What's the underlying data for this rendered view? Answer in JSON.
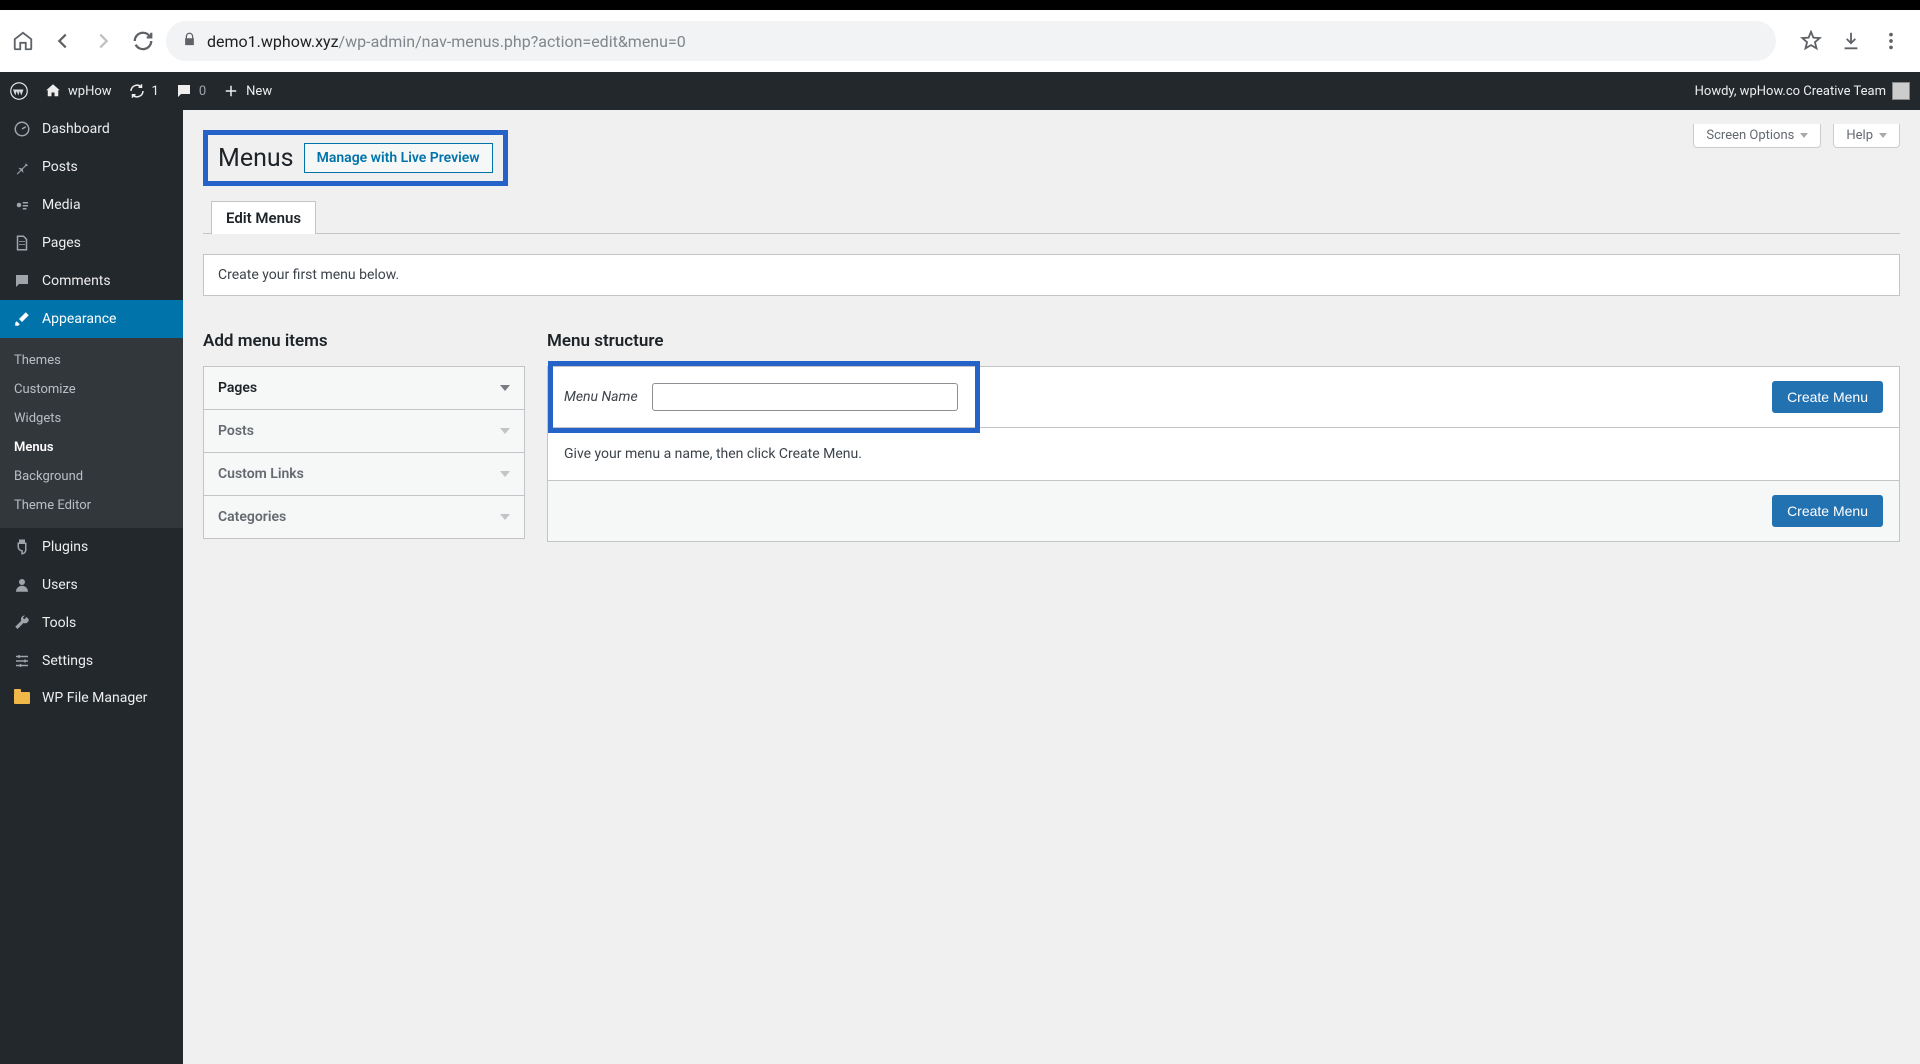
{
  "browser": {
    "url_domain": "demo1.wphow.xyz",
    "url_path": "/wp-admin/nav-menus.php?action=edit&menu=0"
  },
  "adminbar": {
    "site_name": "wpHow",
    "updates": "1",
    "comments": "0",
    "new_label": "New",
    "howdy": "Howdy, wpHow.co Creative Team"
  },
  "sidebar": {
    "items": [
      {
        "label": "Dashboard"
      },
      {
        "label": "Posts"
      },
      {
        "label": "Media"
      },
      {
        "label": "Pages"
      },
      {
        "label": "Comments"
      },
      {
        "label": "Appearance"
      },
      {
        "label": "Plugins"
      },
      {
        "label": "Users"
      },
      {
        "label": "Tools"
      },
      {
        "label": "Settings"
      },
      {
        "label": "WP File Manager"
      }
    ],
    "submenu": [
      {
        "label": "Themes"
      },
      {
        "label": "Customize"
      },
      {
        "label": "Widgets"
      },
      {
        "label": "Menus"
      },
      {
        "label": "Background"
      },
      {
        "label": "Theme Editor"
      }
    ]
  },
  "page": {
    "title": "Menus",
    "live_preview": "Manage with Live Preview",
    "screen_options": "Screen Options",
    "help": "Help",
    "tab_edit": "Edit Menus",
    "notice": "Create your first menu below.",
    "add_heading": "Add menu items",
    "structure_heading": "Menu structure",
    "accordion": [
      "Pages",
      "Posts",
      "Custom Links",
      "Categories"
    ],
    "menu_name_label": "Menu Name",
    "create_menu": "Create Menu",
    "instructions": "Give your menu a name, then click Create Menu."
  }
}
